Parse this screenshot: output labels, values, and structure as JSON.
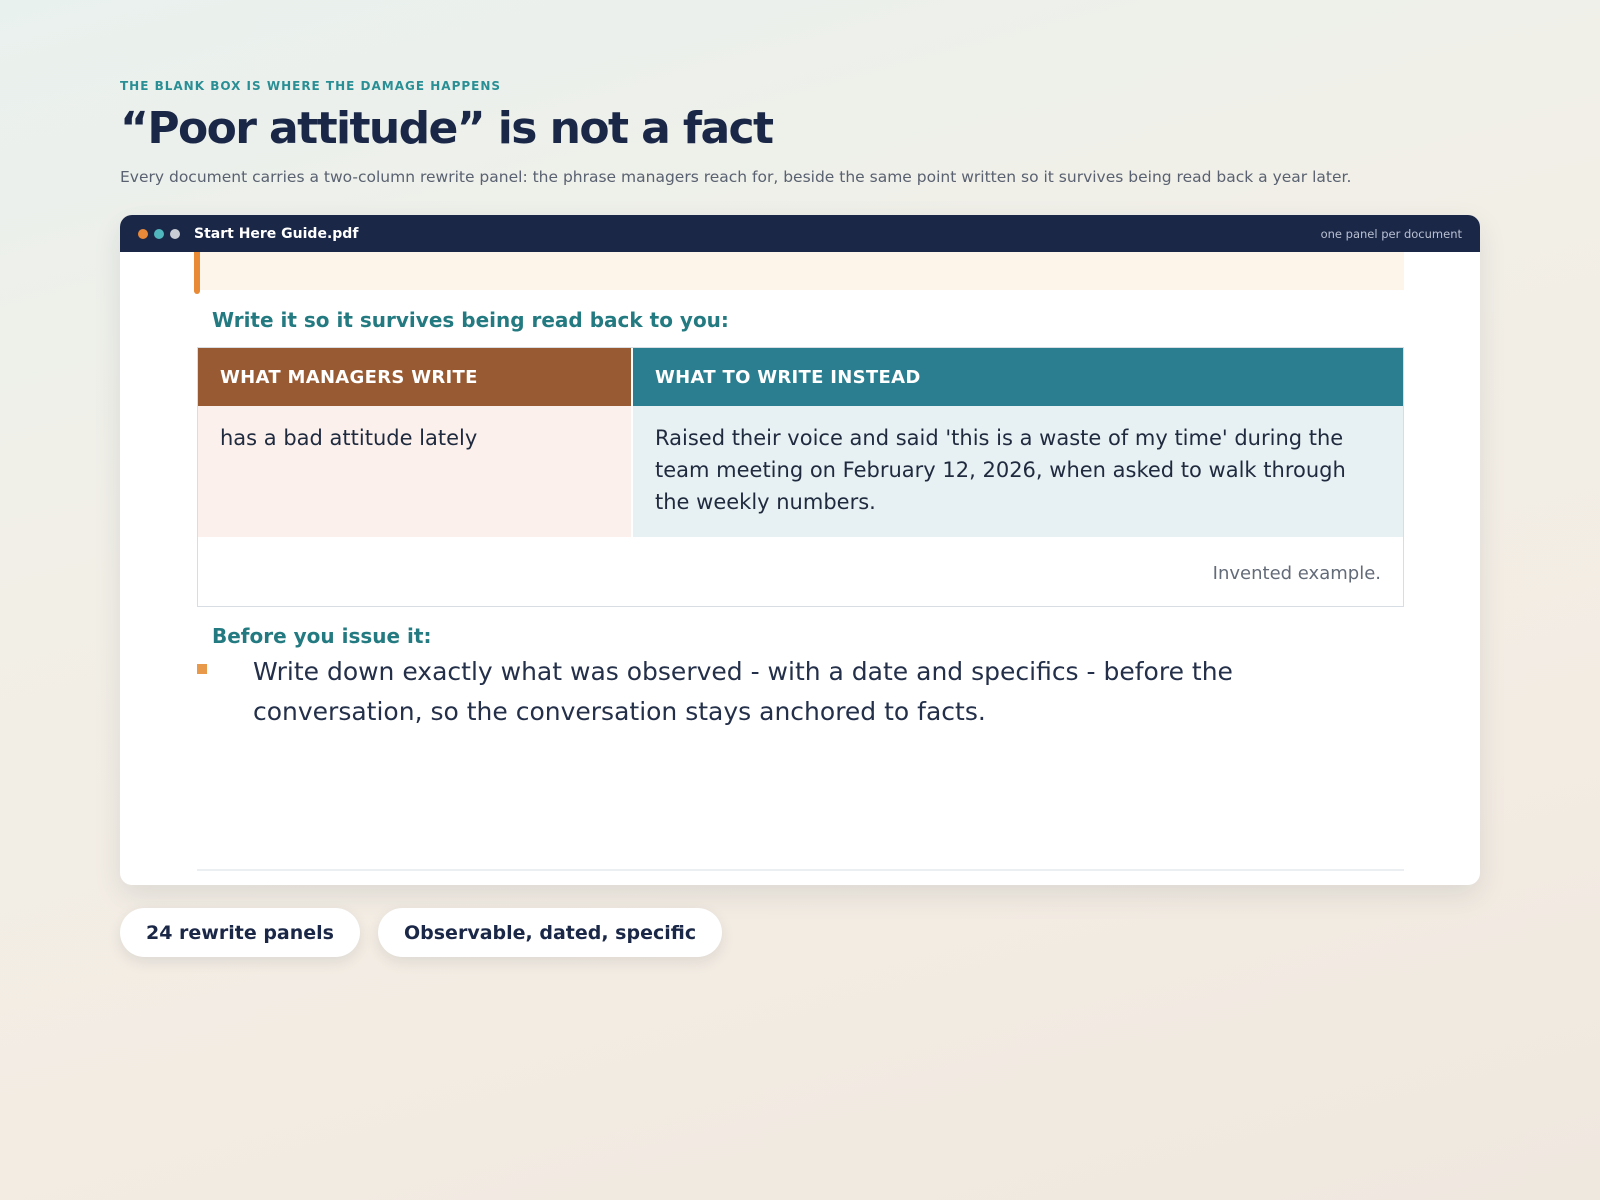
{
  "header": {
    "eyebrow": "THE BLANK BOX IS WHERE THE DAMAGE HAPPENS",
    "title": "“Poor attitude” is not a fact",
    "subtitle": "Every document carries a two-column rewrite panel: the phrase managers reach for, beside the same point written so it survives being read back a year later."
  },
  "window": {
    "filename": "Start Here Guide.pdf",
    "note": "one panel per document",
    "dot_colors": [
      "#e8893a",
      "#4fb7bd",
      "#c9cdd6"
    ]
  },
  "document": {
    "rewrite_heading": "Write it so it survives being read back to you:",
    "columns": {
      "left_header": "WHAT MANAGERS WRITE",
      "right_header": "WHAT TO WRITE INSTEAD",
      "left_text": "has a bad attitude lately",
      "right_text": "Raised their voice and said 'this is a waste of my time' during the team meeting on February 12, 2026, when asked to walk through the weekly numbers."
    },
    "panel_note": "Invented example.",
    "checklist_heading": "Before you issue it:",
    "checklist": [
      "Write down exactly what was observed - with a date and specifics - before the conversation, so the conversation stays anchored to facts."
    ]
  },
  "pills": [
    "24 rewrite panels",
    "Observable, dated, specific"
  ],
  "colors": {
    "accent_teal": "#2a8f95",
    "left_header_bg": "#985a33",
    "right_header_bg": "#2b7e8f",
    "callout_orange": "#e88a36",
    "titlebar_navy": "#1b2747"
  }
}
